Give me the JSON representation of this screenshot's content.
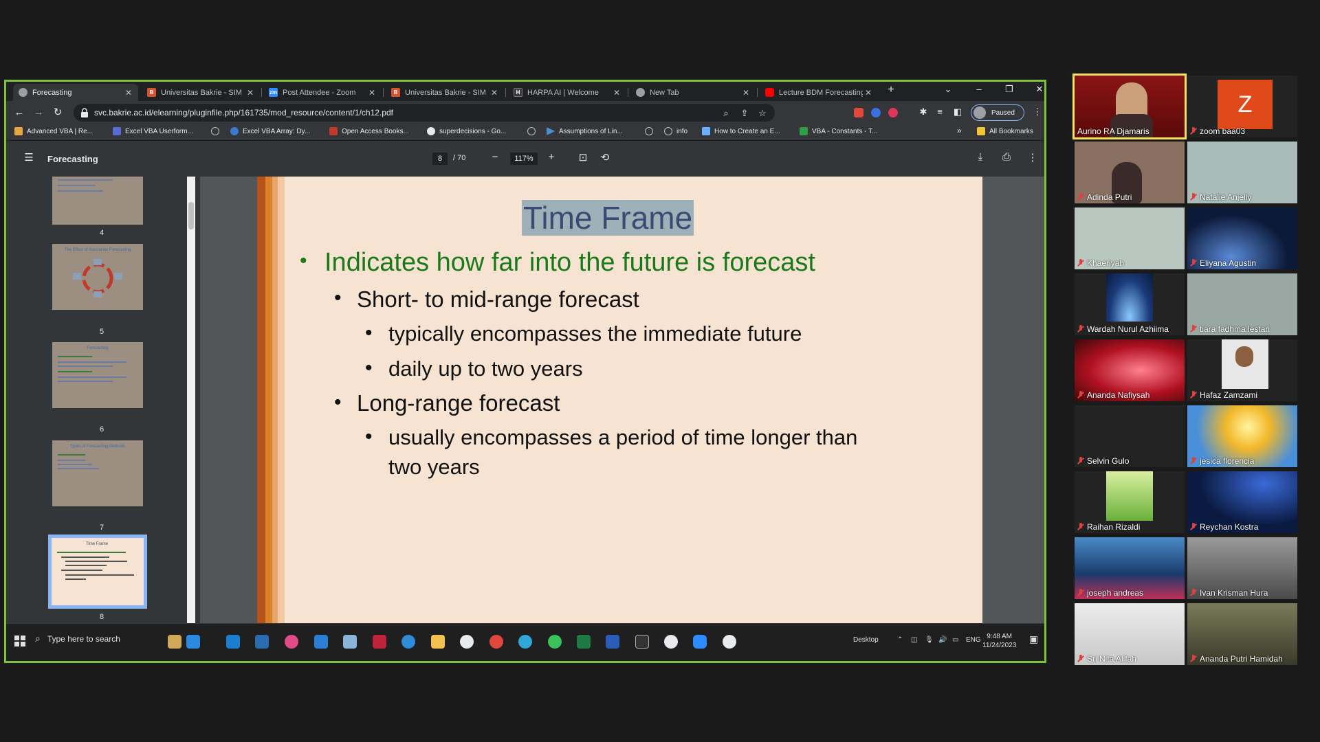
{
  "browser": {
    "tabs": [
      {
        "title": "Forecasting",
        "color": "#9aa0a6",
        "letter": ""
      },
      {
        "title": "Universitas Bakrie - SIM",
        "color": "#d9532c",
        "letter": "B"
      },
      {
        "title": "Post Attendee - Zoom",
        "color": "#2d8cff",
        "letter": "zm"
      },
      {
        "title": "Universitas Bakrie - SIM",
        "color": "#d9532c",
        "letter": "B"
      },
      {
        "title": "HARPA AI | Welcome",
        "color": "#3a3a3a",
        "letter": "H"
      },
      {
        "title": "New Tab",
        "color": "#9aa0a6",
        "letter": ""
      },
      {
        "title": "Lecture BDM Forecasting",
        "color": "#ff0000",
        "letter": ""
      }
    ],
    "url": "svc.bakrie.ac.id/elearning/pluginfile.php/161735/mod_resource/content/1/ch12.pdf",
    "profile_label": "Paused",
    "bookmarks": [
      {
        "label": "Advanced VBA | Re...",
        "color": "#e8a640"
      },
      {
        "label": "Excel VBA Userform...",
        "color": "#5b6bd6"
      },
      {
        "label": "",
        "color": ""
      },
      {
        "label": "Excel VBA Array: Dy...",
        "color": "#3a7ad0"
      },
      {
        "label": "Open Access Books...",
        "color": "#c0392b"
      },
      {
        "label": "superdecisions - Go...",
        "color": "#e8eaed"
      },
      {
        "label": "",
        "color": ""
      },
      {
        "label": "Assumptions of Lin...",
        "color": "#4a90d9"
      },
      {
        "label": "",
        "color": ""
      },
      {
        "label": "info",
        "color": ""
      },
      {
        "label": "How to Create an E...",
        "color": "#6ab0ff"
      },
      {
        "label": "VBA - Constants - T...",
        "color": "#2e9e44"
      }
    ],
    "bookmarks_overflow": "»",
    "all_bookmarks": "All Bookmarks"
  },
  "pdf": {
    "title": "Forecasting",
    "current_page": "8",
    "total_pages": "/ 70",
    "zoom": "117%",
    "thumbnails": [
      {
        "num": "4",
        "title": ""
      },
      {
        "num": "5",
        "title": "The Effect of Inaccurate Forecasting"
      },
      {
        "num": "6",
        "title": "Forecasting"
      },
      {
        "num": "7",
        "title": "Types of Forecasting Methods"
      },
      {
        "num": "8",
        "title": "Time Frame"
      }
    ],
    "slide": {
      "title": "Time Frame",
      "bullets": [
        {
          "level": 1,
          "text": "Indicates how far into the future is forecast"
        },
        {
          "level": 2,
          "text": "Short- to mid-range forecast"
        },
        {
          "level": 3,
          "text": "typically encompasses the immediate future"
        },
        {
          "level": 3,
          "text": "daily up to two years"
        },
        {
          "level": 2,
          "text": "Long-range forecast"
        },
        {
          "level": 3,
          "text": "usually encompasses a period of time longer than"
        },
        {
          "level": 0,
          "text": "two years"
        }
      ]
    }
  },
  "taskbar": {
    "search_placeholder": "Type here to search",
    "desktop_label": "Desktop",
    "language": "ENG",
    "time": "9:48 AM",
    "date": "11/24/2023"
  },
  "participants": [
    {
      "name": "Aurino RA Djamaris",
      "bg": "#7a1010"
    },
    {
      "name": "zoom baa03",
      "bg": "#232323",
      "initial": "Z"
    },
    {
      "name": "Adinda Putri",
      "bg": "#8a7060"
    },
    {
      "name": "Natalie Anjelly",
      "bg": "#a9bcb8"
    },
    {
      "name": "Khaeriyah",
      "bg": "#b8c8c0"
    },
    {
      "name": "Eliyana Agustin",
      "bg": "#0c1a3a"
    },
    {
      "name": "Wardah Nurul Azhiima",
      "bg": "#1a3a7a"
    },
    {
      "name": "tiara fadhma lestari",
      "bg": "#9aa8a4"
    },
    {
      "name": "Ananda Nafiysah",
      "bg": "#b01020"
    },
    {
      "name": "Hafaz Zamzami",
      "bg": "#232323"
    },
    {
      "name": "Selvin Gulo",
      "bg": "#232323"
    },
    {
      "name": "jesica florencia",
      "bg": "#d8a838"
    },
    {
      "name": "Raihan Rizaldi",
      "bg": "#232323"
    },
    {
      "name": "Reychan Kostra",
      "bg": "#0a1a40"
    },
    {
      "name": "joseph andreas",
      "bg": "#1a4a8a"
    },
    {
      "name": "Ivan Krisman Hura",
      "bg": "#6a6a6a"
    },
    {
      "name": "Sri Nita Alifah",
      "bg": "#d8d8d8"
    },
    {
      "name": "Ananda Putri Hamidah",
      "bg": "#4a4a3a"
    }
  ],
  "colors": {
    "share_border": "#7ec13a",
    "slide_bg": "#f6e3d2",
    "level1_text": "#1a7a1a",
    "title_text": "#3a4b73",
    "speaker_outline": "#f7e35a"
  }
}
